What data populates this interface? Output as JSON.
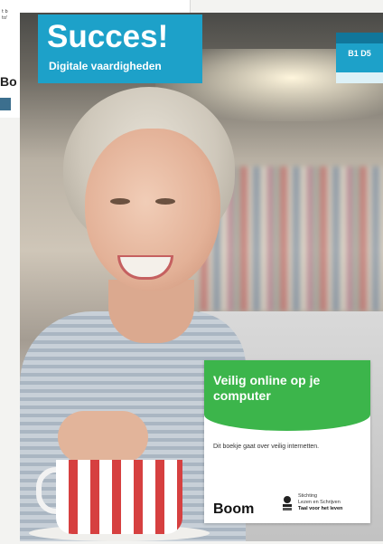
{
  "background_page": {
    "text_fragments": [
      "t b",
      "to'"
    ],
    "partial_label": "Bo"
  },
  "cover": {
    "title": "Succes!",
    "subtitle": "Digitale vaardigheden",
    "level": "B1 D5",
    "info_box": {
      "title": "Veilig online op je computer",
      "description": "Dit boekje gaat over veilig internetten.",
      "publisher": "Boom",
      "organization": {
        "line1": "Stichting",
        "line2": "Lezen en Schrijven",
        "tagline": "Taal voor het leven"
      }
    }
  },
  "colors": {
    "brand_blue": "#1da1c9",
    "green": "#3cb54b",
    "white": "#ffffff"
  }
}
